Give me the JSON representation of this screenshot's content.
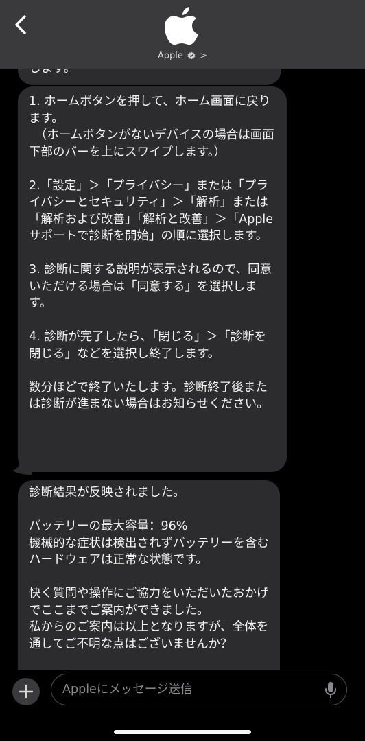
{
  "header": {
    "contact_name": "Apple",
    "back_icon": "chevron-left-icon",
    "avatar_icon": "apple-logo-icon",
    "verified_icon": "verified-badge-icon",
    "chevron": ">"
  },
  "messages": [
    {
      "text": "します。"
    },
    {
      "text": "1. ホームボタンを押して、ホーム画面に戻ります。\n　（ホームボタンがないデバイスの場合は画面下部のバーを上にスワイプします。）\n\n2.「設定」＞「プライバシー」または「プライバシーとセキュリティ」＞「解析」または「解析および改善」「解析と改善」＞「Apple サポートで診断を開始」の順に選択します。\n\n3. 診断に関する説明が表示されるので、同意いただける場合は「同意する」を選択します。\n\n4. 診断が完了したら、「閉じる」＞「診断を閉じる」などを選択し終了します。\n\n数分ほどで終了いたします。診断終了後または診断が進まない場合はお知らせください。"
    },
    {
      "text": "診断結果が反映されました。\n\nバッテリーの最大容量：96%\n機械的な症状は検出されずバッテリーを含むハードウェアは正常な状態です。\n\n快く質問や操作にご協力をいただいたおかげでここまでご案内ができました。\n私からのご案内は以上となりますが、全体を通してご不明な点はございませんか？"
    }
  ],
  "composer": {
    "placeholder": "Appleにメッセージ送信",
    "plus_icon": "plus-icon",
    "mic_icon": "microphone-icon"
  },
  "colors": {
    "header_bg": "#3a3a3c",
    "bubble_bg": "#2c2c2e",
    "background": "#000000"
  }
}
